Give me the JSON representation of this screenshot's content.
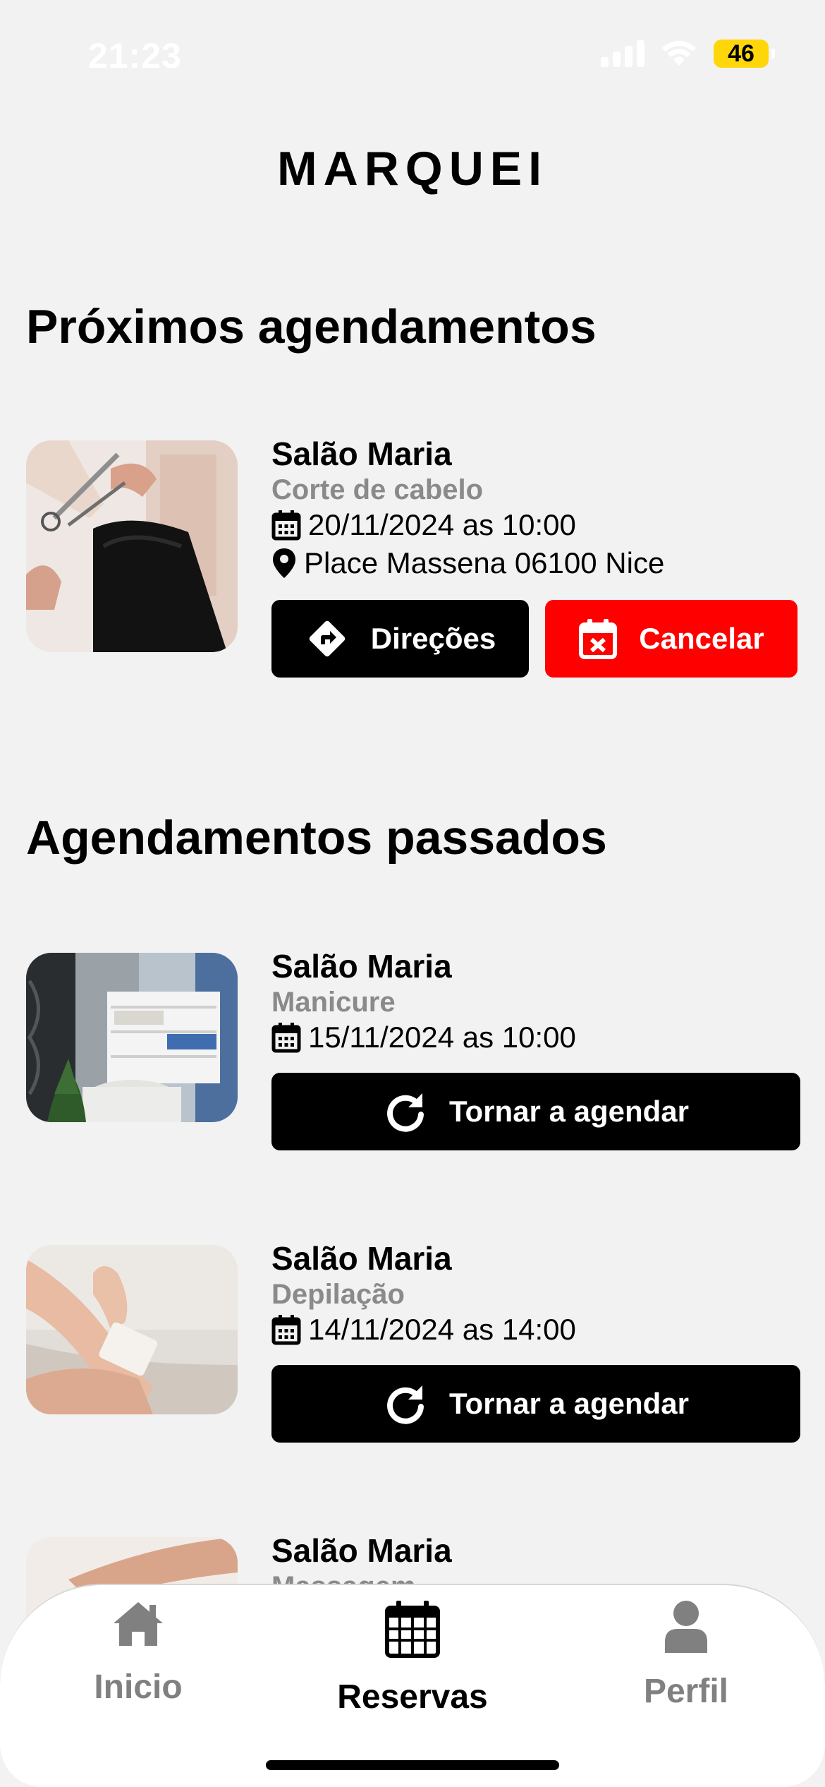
{
  "status_bar": {
    "time": "21:23",
    "battery": "46"
  },
  "app": {
    "title": "MARQUEI"
  },
  "upcoming": {
    "section_title": "Próximos agendamentos",
    "items": [
      {
        "salon": "Salão Maria",
        "service": "Corte de cabelo",
        "datetime": "20/11/2024 as 10:00",
        "address": "Place Massena 06100 Nice",
        "directions_label": "Direções",
        "cancel_label": "Cancelar",
        "image": "haircut-photo"
      }
    ]
  },
  "past": {
    "section_title": "Agendamentos passados",
    "items": [
      {
        "salon": "Salão Maria",
        "service": "Manicure",
        "datetime": "15/11/2024 as 10:00",
        "rebook_label": "Tornar a agendar",
        "image": "salon-interior-photo"
      },
      {
        "salon": "Salão Maria",
        "service": "Depilação",
        "datetime": "14/11/2024 as 14:00",
        "rebook_label": "Tornar a agendar",
        "image": "waxing-photo"
      },
      {
        "salon": "Salão Maria",
        "service": "Massagem",
        "image": "massage-photo"
      }
    ]
  },
  "nav": {
    "items": [
      {
        "label": "Inicio",
        "icon": "home-icon",
        "active": false
      },
      {
        "label": "Reservas",
        "icon": "calendar-icon",
        "active": true
      },
      {
        "label": "Perfil",
        "icon": "user-icon",
        "active": false
      }
    ]
  },
  "colors": {
    "background": "#f2f2f2",
    "primary_button": "#000000",
    "cancel_button": "#ff0000",
    "muted_text": "#8a8a8a",
    "battery": "#ffd60a"
  }
}
